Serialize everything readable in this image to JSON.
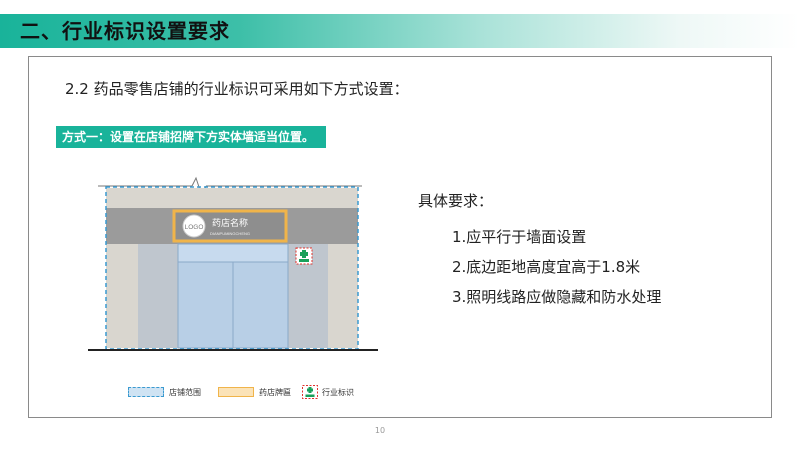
{
  "header": {
    "title": "二、行业标识设置要求",
    "accent_color": "#19b39a"
  },
  "intro": "2.2 药品零售店铺的行业标识可采用如下方式设置：",
  "method": {
    "label": "方式一：设置在店铺招牌下方实体墙适当位置。"
  },
  "illustration": {
    "sign_name": "药店名称",
    "sign_subtitle": "DIANPUMINGCHENG",
    "logo_text": "LOGO",
    "icons": [
      "pharmacy-cross-icon",
      "logo-circle-icon"
    ]
  },
  "legend": {
    "items": [
      {
        "label": "店铺范围",
        "icon": "dashed-range-icon"
      },
      {
        "label": "药店牌匾",
        "icon": "signboard-icon"
      },
      {
        "label": "行业标识",
        "icon": "pharmacy-mark-icon"
      }
    ]
  },
  "requirements": {
    "heading": "具体要求：",
    "items": [
      "1.应平行于墙面设置",
      "2.底边距地高度宜高于1.8米",
      "3.照明线路应做隐藏和防水处理"
    ]
  },
  "page_number": "10"
}
